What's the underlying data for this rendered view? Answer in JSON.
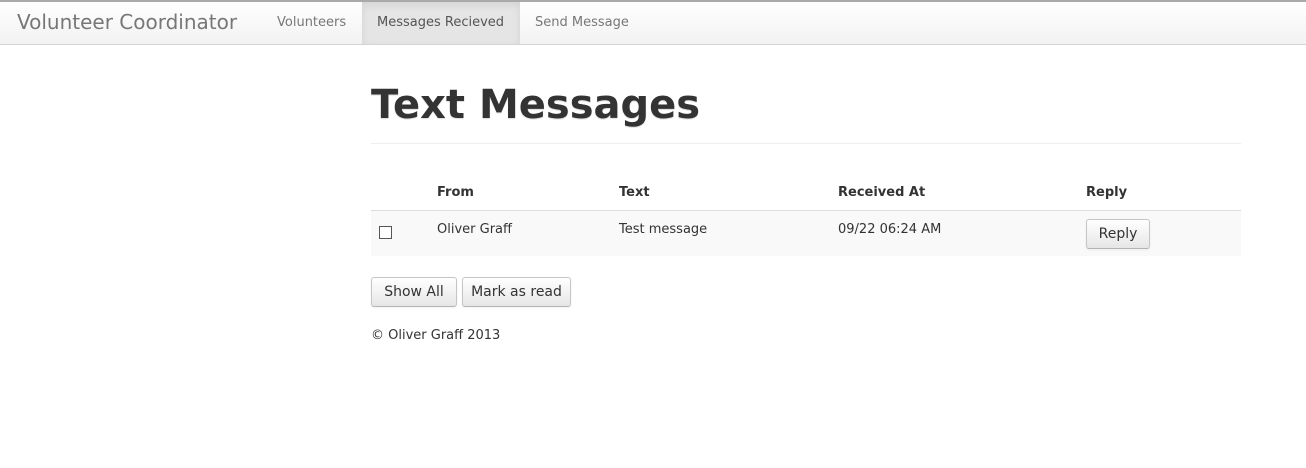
{
  "app": {
    "brand": "Volunteer Coordinator"
  },
  "nav": {
    "items": [
      {
        "label": "Volunteers",
        "active": false
      },
      {
        "label": "Messages Recieved",
        "active": true
      },
      {
        "label": "Send Message",
        "active": false
      }
    ]
  },
  "page": {
    "title": "Text Messages"
  },
  "table": {
    "columns": [
      "",
      "From",
      "Text",
      "Received At",
      "Reply"
    ],
    "rows": [
      {
        "checked": false,
        "from": "Oliver Graff",
        "text": "Test message",
        "received_at": "09/22 06:24 AM",
        "reply_label": "Reply"
      }
    ]
  },
  "actions": {
    "show_all_label": "Show All",
    "mark_read_label": "Mark as read"
  },
  "footer": {
    "text": "© Oliver Graff 2013"
  },
  "colors": {
    "nav_active_bg": "#e5e5e5",
    "row_stripe": "#f9f9f9",
    "text": "#333333",
    "muted": "#777777"
  }
}
